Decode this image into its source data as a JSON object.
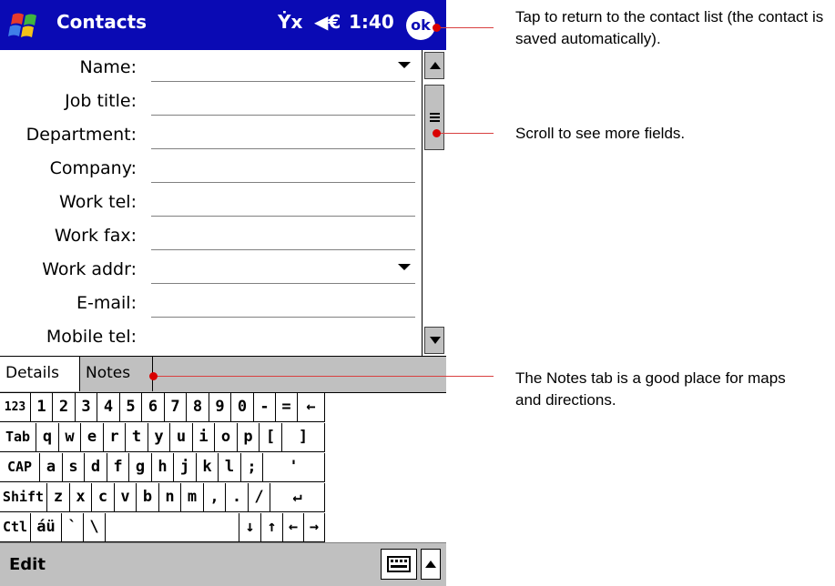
{
  "title_bar": {
    "app_title": "Contacts",
    "status_connectivity": "Ẏx",
    "status_volume": "◀€",
    "time": "1:40",
    "ok_label": "ok"
  },
  "form": {
    "fields": [
      {
        "label": "Name:",
        "has_dropdown": true
      },
      {
        "label": "Job title:",
        "has_dropdown": false
      },
      {
        "label": "Department:",
        "has_dropdown": false
      },
      {
        "label": "Company:",
        "has_dropdown": false
      },
      {
        "label": "Work tel:",
        "has_dropdown": false
      },
      {
        "label": "Work fax:",
        "has_dropdown": false
      },
      {
        "label": "Work addr:",
        "has_dropdown": true
      },
      {
        "label": "E-mail:",
        "has_dropdown": false
      },
      {
        "label": "Mobile tel:",
        "has_dropdown": false
      }
    ]
  },
  "tabs": [
    {
      "label": "Details",
      "active": true
    },
    {
      "label": "Notes",
      "active": false
    }
  ],
  "keyboard": {
    "rows": [
      [
        "123",
        "1",
        "2",
        "3",
        "4",
        "5",
        "6",
        "7",
        "8",
        "9",
        "0",
        "-",
        "=",
        "←"
      ],
      [
        "Tab",
        "q",
        "w",
        "e",
        "r",
        "t",
        "y",
        "u",
        "i",
        "o",
        "p",
        "[",
        "]"
      ],
      [
        "CAP",
        "a",
        "s",
        "d",
        "f",
        "g",
        "h",
        "j",
        "k",
        "l",
        ";",
        "'"
      ],
      [
        "Shift",
        "z",
        "x",
        "c",
        "v",
        "b",
        "n",
        "m",
        ",",
        ".",
        "/",
        "↵"
      ],
      [
        "Ctl",
        "áü",
        "`",
        "\\",
        " ",
        "↓",
        "↑",
        "←",
        "→"
      ]
    ]
  },
  "menu_bar": {
    "edit_label": "Edit"
  },
  "callouts": {
    "ok": "Tap to return to the contact list (the contact is saved automatically).",
    "scroll": "Scroll to see more fields.",
    "notes": "The Notes tab is a good place for maps and directions."
  },
  "colors": {
    "title_bar": "#0a0ab4",
    "chrome_gray": "#c0c0c0",
    "callout_line": "#d94040"
  }
}
